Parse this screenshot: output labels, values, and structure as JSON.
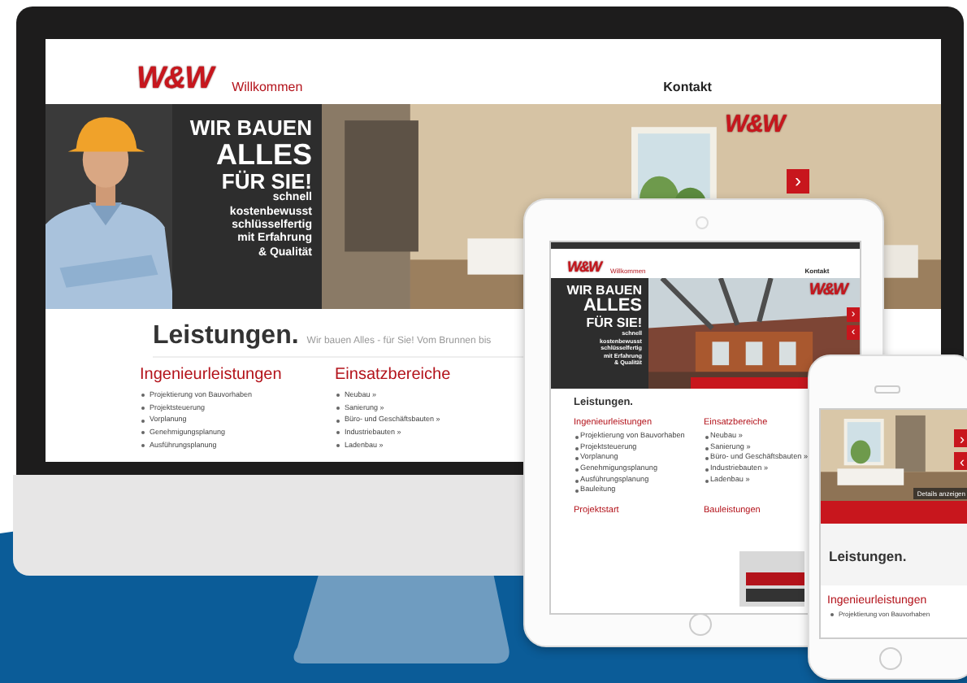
{
  "monitor": {
    "logo": "W&W",
    "nav": [
      {
        "label": "Willkommen",
        "selected": true
      },
      {
        "label": "Kontakt",
        "selected": false
      }
    ],
    "hero": {
      "headline": [
        "WIR BAUEN",
        "ALLES",
        "FÜR SIE!"
      ],
      "tagline": [
        "schnell",
        "kostenbewusst",
        "schlüsselfertig"
      ],
      "claim": [
        "mit Erfahrung",
        "& Qualität"
      ],
      "photo_logo": "W&W",
      "arrows": [
        "›"
      ]
    },
    "section": {
      "title": "Leistungen.",
      "subtitle": "Wir bauen Alles - für Sie! Vom Brunnen bis"
    },
    "columns": [
      {
        "heading": "Ingenieurleistungen",
        "items": [
          "Projektierung von Bauvorhaben",
          "Projektsteuerung",
          "Vorplanung",
          "Genehmigungsplanung",
          "Ausführungsplanung"
        ]
      },
      {
        "heading": "Einsatzbereiche",
        "items": [
          "Neubau »",
          "Sanierung »",
          "Büro- und Geschäftsbauten »",
          "Industriebauten »",
          "Ladenbau »"
        ]
      }
    ]
  },
  "tablet": {
    "logo": "W&W",
    "nav": [
      {
        "label": "Willkommen",
        "selected": true
      },
      {
        "label": "Kontakt",
        "selected": false
      }
    ],
    "hero": {
      "headline": [
        "WIR BAUEN",
        "ALLES",
        "FÜR SIE!"
      ],
      "tagline": [
        "schnell",
        "kostenbewusst",
        "schlüsselfertig"
      ],
      "claim": [
        "mit Erfahrung",
        "& Qualität"
      ],
      "photo_logo": "W&W",
      "arrows": [
        "›",
        "‹"
      ]
    },
    "section": {
      "title": "Leistungen."
    },
    "columns": [
      {
        "heading": "Ingenieurleistungen",
        "items": [
          "Projektierung von Bauvorhaben",
          "Projektsteuerung",
          "Vorplanung",
          "Genehmigungsplanung",
          "Ausführungsplanung",
          "Bauleitung"
        ]
      },
      {
        "heading": "Einsatzbereiche",
        "items": [
          "Neubau »",
          "Sanierung »",
          "Büro- und Geschäftsbauten »",
          "Industriebauten »",
          "Ladenbau »"
        ]
      },
      {
        "heading": "Projektstart"
      },
      {
        "heading": "Bauleistungen"
      }
    ]
  },
  "phone": {
    "arrows": [
      "›",
      "‹"
    ],
    "details": "Details anzeigen",
    "section": {
      "title": "Leistungen."
    },
    "heading": "Ingenieurleistungen",
    "items": [
      "Projektierung von Bauvorhaben"
    ]
  }
}
